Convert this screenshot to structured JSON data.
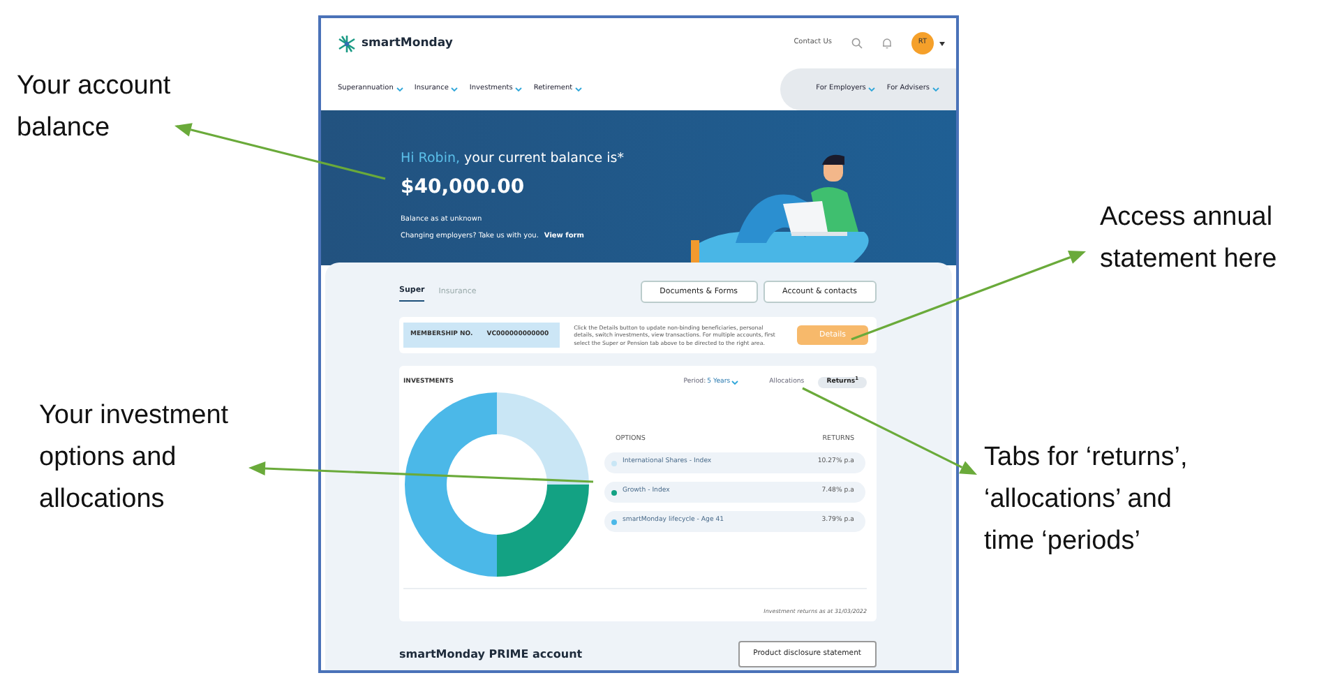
{
  "annotations": [
    {
      "lines": [
        "Your account",
        "balance"
      ]
    },
    {
      "lines": [
        "Access annual",
        "statement here"
      ]
    },
    {
      "lines": [
        "Your investment",
        "options and",
        "allocations"
      ]
    },
    {
      "lines": [
        "Tabs for ‘returns’,",
        "‘allocations’ and",
        "time ‘periods’"
      ]
    }
  ],
  "header": {
    "logo": "smartMonday",
    "contact": "Contact Us",
    "avatar": "RT",
    "nav": [
      "Superannuation",
      "Insurance",
      "Investments",
      "Retirement"
    ],
    "secondary_nav": [
      "For Employers",
      "For Advisers"
    ]
  },
  "hero": {
    "greeting_name": "Hi Robin,",
    "greeting_rest": "your current balance is*",
    "balance": "$40,000.00",
    "as_at": "Balance as at unknown",
    "changing": "Changing employers? Take us with you.",
    "link": "View form"
  },
  "tabs": [
    {
      "label": "Super",
      "selected": true
    },
    {
      "label": "Insurance",
      "selected": false
    }
  ],
  "actions": [
    "Documents & Forms",
    "Account & contacts"
  ],
  "membership": {
    "label": "MEMBERSHIP NO.",
    "number": "VC000000000000",
    "note": "Click the Details button to update non-binding beneficiaries, personal details, switch investments, view transactions. For multiple accounts, first select the Super or Pension tab above to be directed to the right area.",
    "button": "Details"
  },
  "investments": {
    "title": "INVESTMENTS",
    "period_label": "Period:",
    "period": "5 Years",
    "views": [
      {
        "label": "Allocations",
        "selected": false
      },
      {
        "label": "Returns$^{1}$",
        "selected": true
      }
    ],
    "columns": [
      "OPTIONS",
      "RETURNS"
    ],
    "options": [
      {
        "name": "International Shares - Index",
        "return": "10.27% p.a",
        "color": "#c9e6f5"
      },
      {
        "name": "Growth - Index",
        "return": "7.48% p.a",
        "color": "#13a283"
      },
      {
        "name": "smartMonday lifecycle - Age 41",
        "return": "3.79% p.a",
        "color": "#4bb8e8"
      }
    ],
    "footnote": "Investment returns as at 31/03/2022"
  },
  "account": {
    "title": "smartMonday PRIME account",
    "button": "Product disclosure statement"
  }
}
